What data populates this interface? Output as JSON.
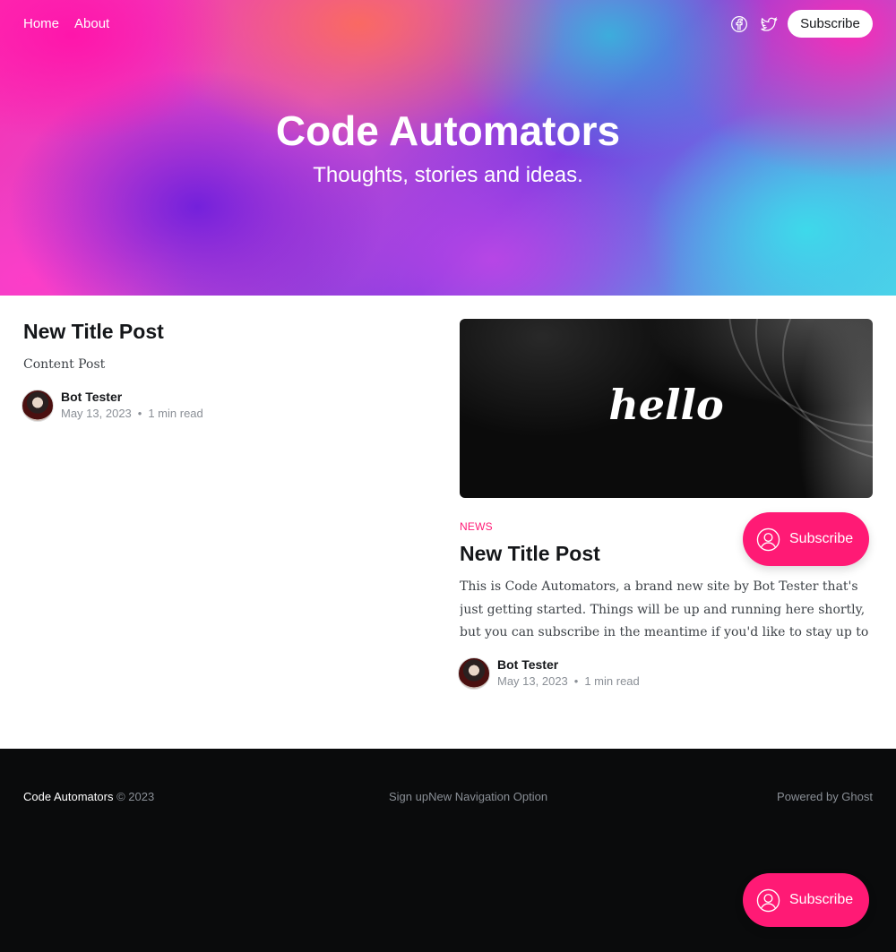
{
  "nav": {
    "items": [
      "Home",
      "About"
    ]
  },
  "header": {
    "social": [
      "facebook-icon",
      "twitter-icon"
    ],
    "subscribe_label": "Subscribe"
  },
  "site": {
    "title": "Code Automators",
    "description": "Thoughts, stories and ideas."
  },
  "posts": [
    {
      "title": "New Title Post",
      "excerpt": "Content Post",
      "author": "Bot Tester",
      "date": "May 13, 2023",
      "read_time": "1 min read"
    },
    {
      "image_text": "hello",
      "tag": "NEWS",
      "title": "New Title Post",
      "excerpt": "This is Code Automators, a brand new site by Bot Tester that's just getting started. Things will be up and running here shortly, but you can subscribe in the meantime if you'd like to stay up to date and receive emails when new content is published!",
      "author": "Bot Tester",
      "date": "May 13, 2023",
      "read_time": "1 min read"
    }
  ],
  "portal": {
    "label": "Subscribe"
  },
  "footer": {
    "site_name": "Code Automators",
    "copyright": " © 2023",
    "nav": [
      "Sign up",
      "New Navigation Option"
    ],
    "powered": "Powered by Ghost"
  },
  "colors": {
    "accent": "#ff1a75",
    "footer_bg": "#0a0b0c"
  }
}
